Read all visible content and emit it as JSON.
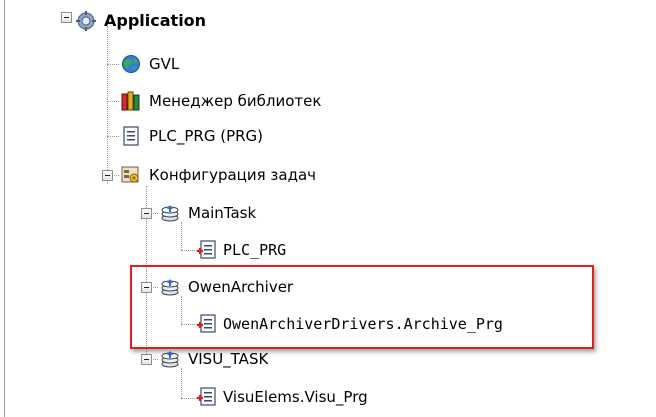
{
  "tree": {
    "application": {
      "label": "Application"
    },
    "gvl": {
      "label": "GVL"
    },
    "library_manager": {
      "label": "Менеджер библиотек"
    },
    "plc_prg": {
      "label": "PLC_PRG (PRG)"
    },
    "task_config": {
      "label": "Конфигурация задач"
    },
    "main_task": {
      "label": "MainTask"
    },
    "main_task_call": {
      "label": "PLC_PRG"
    },
    "owen_archiver": {
      "label": "OwenArchiver"
    },
    "owen_archiver_call": {
      "label": "OwenArchiverDrivers.Archive_Prg"
    },
    "visu_task": {
      "label": "VISU_TASK"
    },
    "visu_task_call": {
      "label": "VisuElems.Visu_Prg"
    }
  },
  "colors": {
    "highlight_border": "#e02020",
    "tree_lines": "#9a9a9a"
  }
}
